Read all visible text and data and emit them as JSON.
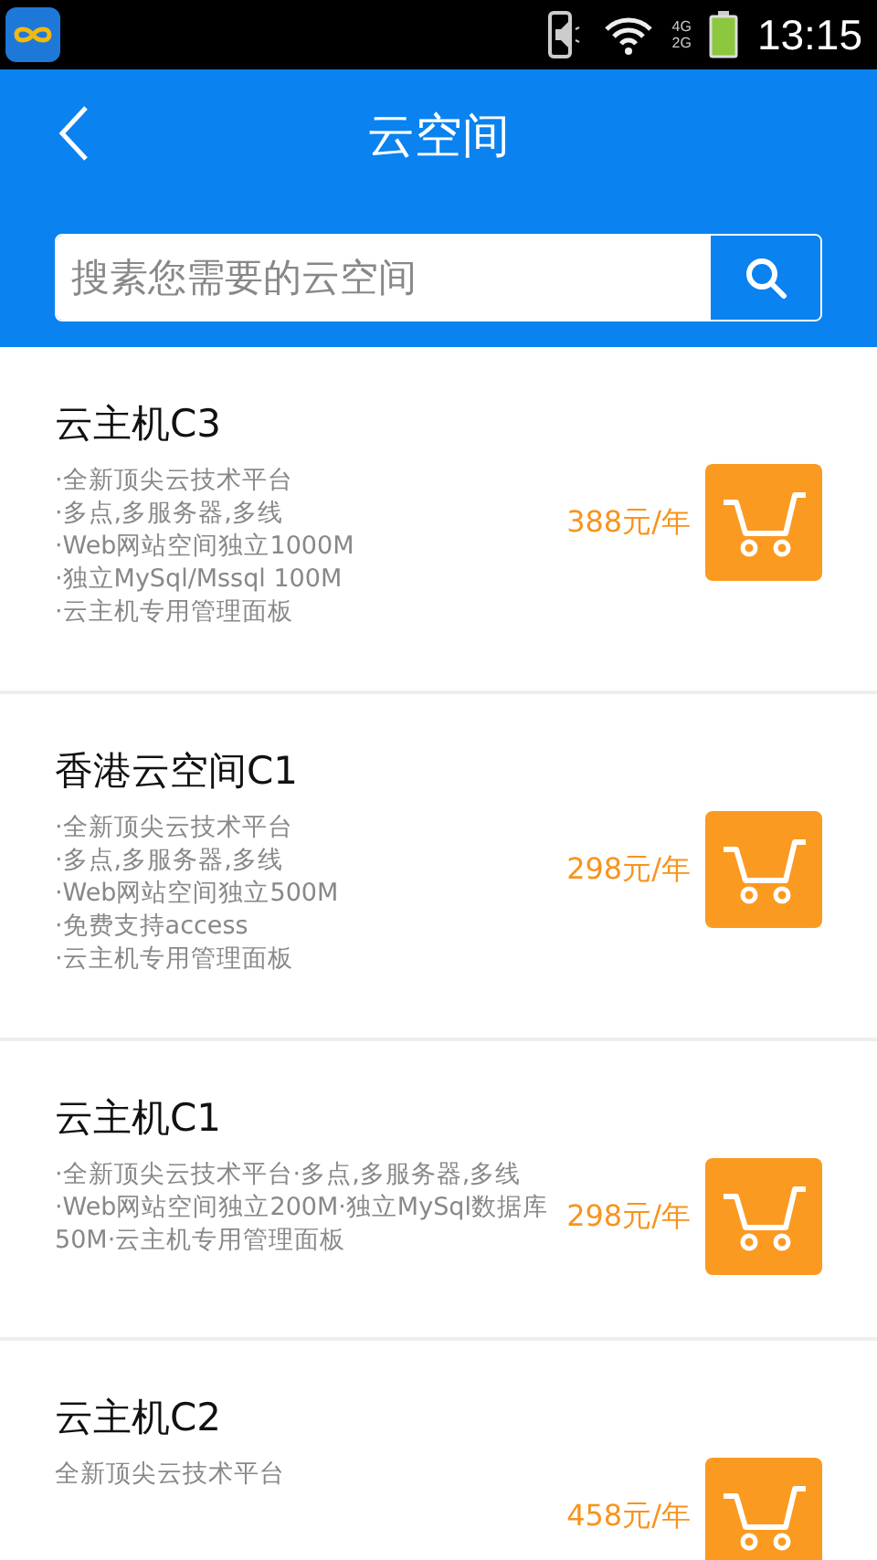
{
  "status_bar": {
    "network_labels": [
      "4G",
      "2G"
    ],
    "time": "13:15"
  },
  "header": {
    "title": "云空间"
  },
  "search": {
    "placeholder": "搜素您需要的云空间"
  },
  "products": [
    {
      "name": "云主机C3",
      "description": [
        "·全新顶尖云技术平台",
        "·多点,多服务器,多线",
        "·Web网站空间独立1000M",
        "·独立MySql/Mssql 100M",
        "·云主机专用管理面板"
      ],
      "price": "388元/年"
    },
    {
      "name": "香港云空间C1",
      "description": [
        "·全新顶尖云技术平台",
        "·多点,多服务器,多线",
        "·Web网站空间独立500M",
        "·免费支持access",
        "·云主机专用管理面板"
      ],
      "price": "298元/年"
    },
    {
      "name": "云主机C1",
      "description": [
        "·全新顶尖云技术平台·多点,多服务器,多线·Web网站空间独立200M·独立MySql数据库50M·云主机专用管理面板"
      ],
      "price": "298元/年"
    },
    {
      "name": "云主机C2",
      "description": [
        "全新顶尖云技术平台"
      ],
      "price": "458元/年"
    }
  ]
}
